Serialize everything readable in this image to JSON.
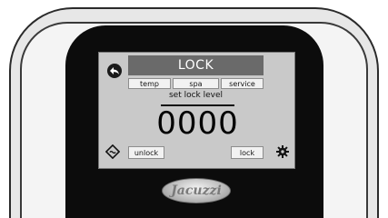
{
  "screen": {
    "title": "LOCK",
    "tabs": [
      {
        "label": "temp"
      },
      {
        "label": "spa"
      },
      {
        "label": "service"
      }
    ],
    "lock_label": "set lock level",
    "lock_code": "0000",
    "unlock_label": "unlock",
    "lock_label_button": "lock"
  },
  "brand": {
    "logo_text": "Jacuzzi"
  },
  "colors": {
    "title_bar": "#6a6a6a",
    "screen_bg": "#c9c9c9",
    "panel": "#0c0c0c"
  },
  "icons": {
    "back": "back-arrow-icon",
    "mode": "wave-mode-icon",
    "settings": "gear-icon"
  }
}
